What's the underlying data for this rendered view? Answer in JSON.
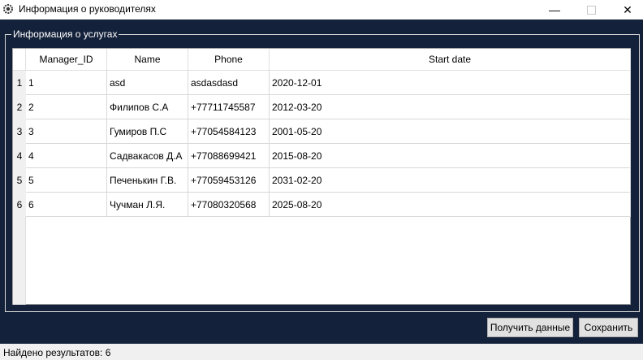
{
  "window": {
    "title": "Информация о руководителях",
    "minimize": "—",
    "close": "✕"
  },
  "group": {
    "title": "Информация о услугах"
  },
  "table": {
    "headers": [
      "Manager_ID",
      "Name",
      "Phone",
      "Start date"
    ],
    "row_numbers": [
      "1",
      "2",
      "3",
      "4",
      "5",
      "6"
    ],
    "rows": [
      [
        "1",
        "asd",
        "asdasdasd",
        "2020-12-01"
      ],
      [
        "2",
        "Филипов С.А",
        "+77711745587",
        "2012-03-20"
      ],
      [
        "3",
        "Гумиров П.С",
        "+77054584123",
        "2001-05-20"
      ],
      [
        "4",
        "Садвакасов Д.А",
        "+77088699421",
        "2015-08-20"
      ],
      [
        "5",
        "Печенькин Г.В.",
        "+77059453126",
        "2031-02-20"
      ],
      [
        "6",
        "Чучман Л.Я.",
        "+77080320568",
        "2025-08-20"
      ]
    ]
  },
  "buttons": {
    "get_data": "Получить данные",
    "save": "Сохранить"
  },
  "status": {
    "text": "Найдено результатов: 6"
  },
  "icons": {
    "app": "gear-app-icon",
    "minimize": "minimize-icon",
    "maximize": "maximize-icon",
    "close": "close-icon"
  }
}
